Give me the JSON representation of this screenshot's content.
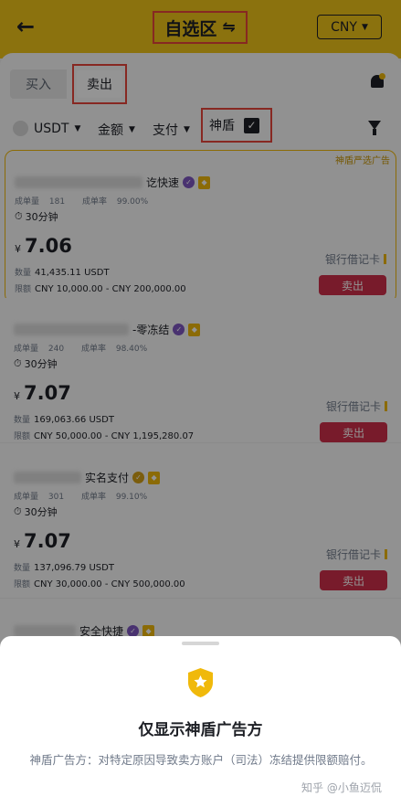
{
  "header": {
    "back_glyph": "←",
    "title": "自选区",
    "swap_glyph": "⇋",
    "currency": "CNY",
    "currency_caret": "▼"
  },
  "tabs": {
    "buy": "买入",
    "sell": "卖出"
  },
  "filters": {
    "coin": "USDT",
    "amount": "金额",
    "payment": "支付",
    "shield": "神盾",
    "shield_checked": true,
    "caret": "▼",
    "check_glyph": "✓"
  },
  "featured_tag": "神盾严选广告",
  "labels": {
    "qty": "数量",
    "limit": "限额",
    "sell": "卖出",
    "orders": "成单量",
    "rate": "成单率"
  },
  "ads": [
    {
      "name_suffix": "讫快速",
      "badge": "purple",
      "orders": "181",
      "rate": "99.00%",
      "time": "30分钟",
      "currency_symbol": "¥",
      "price": "7.06",
      "qty": "41,435.11 USDT",
      "limit": "CNY 10,000.00 - CNY 200,000.00",
      "pay": "银行借记卡",
      "sell": "卖出"
    },
    {
      "name_suffix": "-零冻结",
      "badge": "purple",
      "orders": "240",
      "rate": "98.40%",
      "time": "30分钟",
      "currency_symbol": "¥",
      "price": "7.07",
      "qty": "169,063.66 USDT",
      "limit": "CNY 50,000.00 - CNY 1,195,280.07",
      "pay": "银行借记卡",
      "sell": "卖出"
    },
    {
      "name_suffix": "实名支付",
      "badge": "gold",
      "orders": "301",
      "rate": "99.10%",
      "time": "30分钟",
      "currency_symbol": "¥",
      "price": "7.07",
      "qty": "137,096.79 USDT",
      "limit": "CNY 30,000.00 - CNY 500,000.00",
      "pay": "银行借记卡",
      "sell": "卖出"
    },
    {
      "name_suffix": "安全快捷",
      "badge": "purple"
    }
  ],
  "popup": {
    "title": "仅显示神盾广告方",
    "description": "神盾广告方：对特定原因导致卖方账户（司法）冻结提供限额赔付。"
  },
  "watermark": "知乎 @小鱼迈侃",
  "colors": {
    "brand_yellow": "#f0c419",
    "sell_red": "#cf304a",
    "highlight_red": "#e8453c",
    "featured_border": "#f0b90b"
  }
}
